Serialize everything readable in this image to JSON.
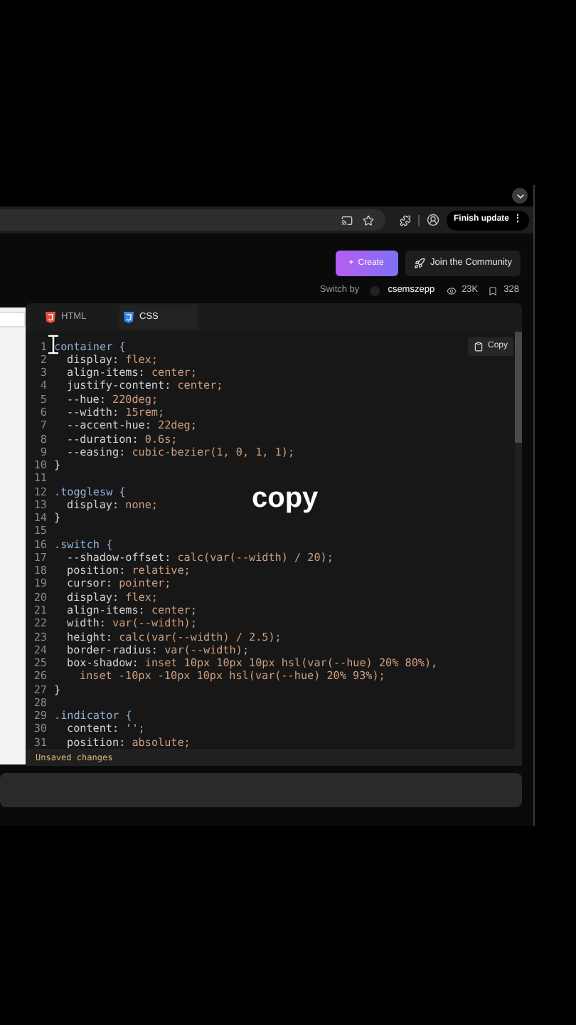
{
  "browser": {
    "update_button": "Finish update",
    "update_menu_glyph": "⋮"
  },
  "header": {
    "create_button": "Create",
    "create_glyph": "+",
    "community_button": "Join the Community"
  },
  "meta": {
    "prefix": "Switch by",
    "author": "csemszepp",
    "views": "23K",
    "saves": "328"
  },
  "editor": {
    "tabs": [
      {
        "label": "HTML",
        "kind": "html",
        "selected": false
      },
      {
        "label": "CSS",
        "kind": "css",
        "selected": true
      }
    ],
    "copy_button": "Copy",
    "lines": [
      {
        "n": "1",
        "kind": "selector",
        "text": "container {"
      },
      {
        "n": "2",
        "kind": "declaration",
        "property": "display:",
        "value": " flex;"
      },
      {
        "n": "3",
        "kind": "declaration",
        "property": "align-items:",
        "value": " center;"
      },
      {
        "n": "4",
        "kind": "declaration",
        "property": "justify-content:",
        "value": " center;"
      },
      {
        "n": "5",
        "kind": "declaration",
        "property": "--hue:",
        "value": " 220deg;"
      },
      {
        "n": "6",
        "kind": "declaration",
        "property": "--width:",
        "value": " 15rem;"
      },
      {
        "n": "7",
        "kind": "declaration",
        "property": "--accent-hue:",
        "value": " 22deg;"
      },
      {
        "n": "8",
        "kind": "declaration",
        "property": "--duration:",
        "value": " 0.6s;"
      },
      {
        "n": "9",
        "kind": "declaration",
        "property": "--easing:",
        "value": " cubic-bezier(1, 0, 1, 1);"
      },
      {
        "n": "10",
        "kind": "brace",
        "text": "}"
      },
      {
        "n": "11",
        "kind": "blank"
      },
      {
        "n": "12",
        "kind": "selector",
        "text": ".togglesw {"
      },
      {
        "n": "13",
        "kind": "declaration",
        "property": "display:",
        "value": " none;"
      },
      {
        "n": "14",
        "kind": "brace",
        "text": "}"
      },
      {
        "n": "15",
        "kind": "blank"
      },
      {
        "n": "16",
        "kind": "selector",
        "text": ".switch {"
      },
      {
        "n": "17",
        "kind": "declaration",
        "property": "--shadow-offset:",
        "value": " calc(var(--width) / 20);"
      },
      {
        "n": "18",
        "kind": "declaration",
        "property": "position:",
        "value": " relative;"
      },
      {
        "n": "19",
        "kind": "declaration",
        "property": "cursor:",
        "value": " pointer;"
      },
      {
        "n": "20",
        "kind": "declaration",
        "property": "display:",
        "value": " flex;"
      },
      {
        "n": "21",
        "kind": "declaration",
        "property": "align-items:",
        "value": " center;"
      },
      {
        "n": "22",
        "kind": "declaration",
        "property": "width:",
        "value": " var(--width);"
      },
      {
        "n": "23",
        "kind": "declaration",
        "property": "height:",
        "value": " calc(var(--width) / 2.5);"
      },
      {
        "n": "24",
        "kind": "declaration",
        "property": "border-radius:",
        "value": " var(--width);"
      },
      {
        "n": "25",
        "kind": "declaration",
        "property": "box-shadow:",
        "value": " inset 10px 10px 10px hsl(var(--hue) 20% 80%),"
      },
      {
        "n": "26",
        "kind": "continuation",
        "text": "inset -10px -10px 10px hsl(var(--hue) 20% 93%);"
      },
      {
        "n": "27",
        "kind": "brace",
        "text": "}"
      },
      {
        "n": "28",
        "kind": "blank"
      },
      {
        "n": "29",
        "kind": "selector",
        "text": ".indicator {"
      },
      {
        "n": "30",
        "kind": "declaration",
        "property": "content:",
        "value": " '';"
      },
      {
        "n": "31",
        "kind": "declaration",
        "property": "position:",
        "value": " absolute;"
      }
    ],
    "status": "Unsaved changes"
  },
  "caption": "copy"
}
